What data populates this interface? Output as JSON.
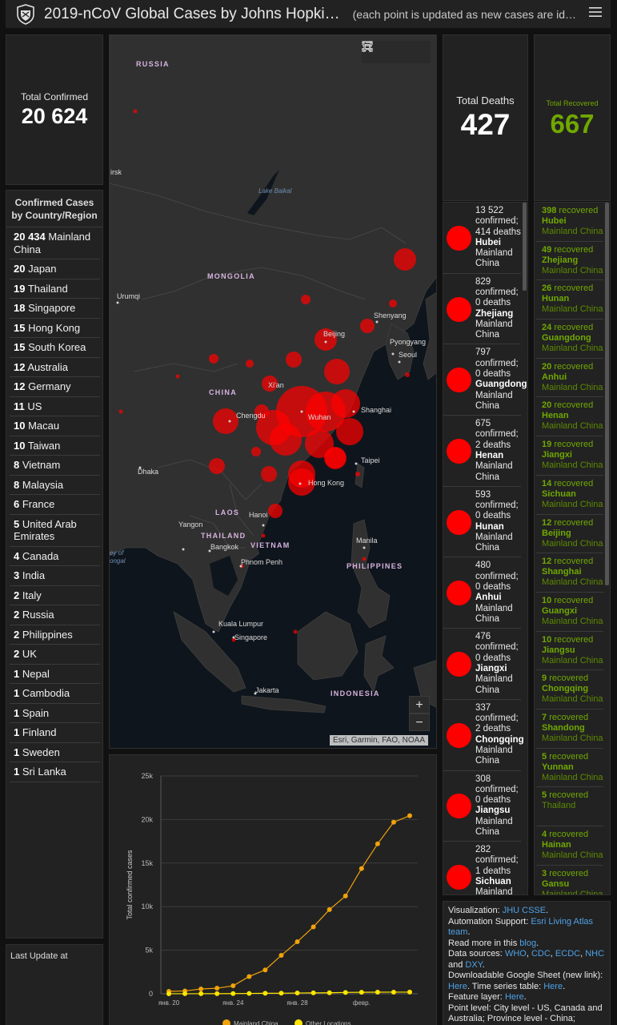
{
  "header": {
    "title": "2019-nCoV Global Cases by Johns Hopki…",
    "subtitle": "(each point is updated as new cases are id…"
  },
  "total_confirmed": {
    "label": "Total Confirmed",
    "value": "20 624"
  },
  "country_list": {
    "title": "Confirmed Cases by Country/Region",
    "items": [
      {
        "count": "20 434",
        "name": "Mainland China"
      },
      {
        "count": "20",
        "name": "Japan"
      },
      {
        "count": "19",
        "name": "Thailand"
      },
      {
        "count": "18",
        "name": "Singapore"
      },
      {
        "count": "15",
        "name": "Hong Kong"
      },
      {
        "count": "15",
        "name": "South Korea"
      },
      {
        "count": "12",
        "name": "Australia"
      },
      {
        "count": "12",
        "name": "Germany"
      },
      {
        "count": "11",
        "name": "US"
      },
      {
        "count": "10",
        "name": "Macau"
      },
      {
        "count": "10",
        "name": "Taiwan"
      },
      {
        "count": "8",
        "name": "Vietnam"
      },
      {
        "count": "8",
        "name": "Malaysia"
      },
      {
        "count": "6",
        "name": "France"
      },
      {
        "count": "5",
        "name": "United Arab Emirates"
      },
      {
        "count": "4",
        "name": "Canada"
      },
      {
        "count": "3",
        "name": "India"
      },
      {
        "count": "2",
        "name": "Italy"
      },
      {
        "count": "2",
        "name": "Russia"
      },
      {
        "count": "2",
        "name": "Philippines"
      },
      {
        "count": "2",
        "name": "UK"
      },
      {
        "count": "1",
        "name": "Nepal"
      },
      {
        "count": "1",
        "name": "Cambodia"
      },
      {
        "count": "1",
        "name": "Spain"
      },
      {
        "count": "1",
        "name": "Finland"
      },
      {
        "count": "1",
        "name": "Sweden"
      },
      {
        "count": "1",
        "name": "Sri Lanka"
      }
    ]
  },
  "last_update": {
    "label": "Last Update at"
  },
  "map": {
    "labels": {
      "russia": "RUSSIA",
      "mongolia": "MONGOLIA",
      "china": "CHINA",
      "laos": "LAOS",
      "thailand": "THAILAND",
      "vietnam": "VIETNAM",
      "philippines": "PHILIPPINES",
      "indonesia": "INDONESIA",
      "lake_baikal": "Lake Baikal",
      "bay_of_bengal": "ey of ongal",
      "irsk": "irsk",
      "urumqi": "Urumqi",
      "beijing": "Beijing",
      "shenyang": "Shenyang",
      "pyongyang": "Pyongyang",
      "seoul": "Seoul",
      "xian": "Xi'an",
      "chengdu": "Chengdu",
      "wuhan": "Wuhan",
      "shanghai": "Shanghai",
      "taipei": "Taipei",
      "dhaka": "Dhaka",
      "hanoi": "Hanoi",
      "hong_kong": "Hong Kong",
      "yangon": "Yangon",
      "bangkok": "Bangkok",
      "manila": "Manila",
      "phnom_penh": "Phnom Penh",
      "kuala_lumpur": "Kuala Lumpur",
      "singapore": "Singapore",
      "jakarta": "Jakarta"
    },
    "attribution": "Esri, Garmin, FAO, NOAA",
    "zoom_in": "+",
    "zoom_out": "−"
  },
  "total_deaths": {
    "label": "Total Deaths",
    "value": "427"
  },
  "deaths_list": [
    {
      "confirmed": "13 522",
      "deaths": "414",
      "province": "Hubei",
      "country": "Mainland China"
    },
    {
      "confirmed": "829",
      "deaths": "0",
      "province": "Zhejiang",
      "country": "Mainland China"
    },
    {
      "confirmed": "797",
      "deaths": "0",
      "province": "Guangdong",
      "country": "Mainland China"
    },
    {
      "confirmed": "675",
      "deaths": "2",
      "province": "Henan",
      "country": "Mainland China"
    },
    {
      "confirmed": "593",
      "deaths": "0",
      "province": "Hunan",
      "country": "Mainland China"
    },
    {
      "confirmed": "480",
      "deaths": "0",
      "province": "Anhui",
      "country": "Mainland China"
    },
    {
      "confirmed": "476",
      "deaths": "0",
      "province": "Jiangxi",
      "country": "Mainland China"
    },
    {
      "confirmed": "337",
      "deaths": "2",
      "province": "Chongqing",
      "country": "Mainland China"
    },
    {
      "confirmed": "308",
      "deaths": "0",
      "province": "Jiangsu",
      "country": "Mainland China"
    },
    {
      "confirmed": "282",
      "deaths": "1",
      "province": "Sichuan",
      "country": "Mainland China"
    }
  ],
  "total_recovered": {
    "label": "Total Recovered",
    "value": "667"
  },
  "recovered_list": [
    {
      "count": "398",
      "province": "Hubei",
      "country": "Mainland China"
    },
    {
      "count": "49",
      "province": "Zhejiang",
      "country": "Mainland China"
    },
    {
      "count": "26",
      "province": "Hunan",
      "country": "Mainland China"
    },
    {
      "count": "24",
      "province": "Guangdong",
      "country": "Mainland China"
    },
    {
      "count": "20",
      "province": "Anhui",
      "country": "Mainland China"
    },
    {
      "count": "20",
      "province": "Henan",
      "country": "Mainland China"
    },
    {
      "count": "19",
      "province": "Jiangxi",
      "country": "Mainland China"
    },
    {
      "count": "14",
      "province": "Sichuan",
      "country": "Mainland China"
    },
    {
      "count": "12",
      "province": "Beijing",
      "country": "Mainland China"
    },
    {
      "count": "12",
      "province": "Shanghai",
      "country": "Mainland China"
    },
    {
      "count": "10",
      "province": "Guangxi",
      "country": "Mainland China"
    },
    {
      "count": "10",
      "province": "Jiangsu",
      "country": "Mainland China"
    },
    {
      "count": "9",
      "province": "Chongqing",
      "country": "Mainland China"
    },
    {
      "count": "7",
      "province": "Shandong",
      "country": "Mainland China"
    },
    {
      "count": "5",
      "province": "Yunnan",
      "country": "Mainland China"
    },
    {
      "count": "5",
      "province": "",
      "country": "Thailand"
    },
    {
      "count": "4",
      "province": "Hainan",
      "country": "Mainland China"
    },
    {
      "count": "3",
      "province": "Gansu",
      "country": "Mainland China"
    }
  ],
  "recovered_word": "recovered",
  "confirmed_word": "confirmed;",
  "deaths_word": "deaths",
  "info": {
    "visualization_label": "Visualization:",
    "visualization_link": "JHU CSSE",
    "automation_label": "Automation Support:",
    "automation_link": "Esri Living Atlas team",
    "read_more_label": "Read more in this",
    "read_more_link": "blog",
    "sources_label": "Data sources:",
    "sources_links": [
      "WHO",
      "CDC",
      "ECDC",
      "NHC",
      "DXY"
    ],
    "sheet_label": "Downloadable Google Sheet (new link):",
    "sheet_link": "Here",
    "timeseries_label": "Time series table:",
    "timeseries_link": "Here",
    "feature_label": "Feature layer:",
    "feature_link": "Here",
    "point_level": "Point level: City level - US, Canada and Australia; Province level - China;"
  },
  "chart_data": {
    "type": "line",
    "ylabel": "Total confirmed cases",
    "xlabel": "",
    "x_tick_labels": [
      "янв. 20",
      "янв. 24",
      "янв. 28",
      "февр."
    ],
    "y_tick_labels": [
      "0",
      "5k",
      "10k",
      "15k",
      "20k",
      "25k"
    ],
    "ylim": [
      0,
      25000
    ],
    "x": [
      "01-20",
      "01-21",
      "01-22",
      "01-23",
      "01-24",
      "01-25",
      "01-26",
      "01-27",
      "01-28",
      "01-29",
      "01-30",
      "01-31",
      "02-01",
      "02-02",
      "02-03",
      "02-04"
    ],
    "series": [
      {
        "name": "Mainland China",
        "color": "#f0a30a",
        "values": [
          278,
          326,
          547,
          639,
          916,
          1979,
          2737,
          4409,
          5970,
          7678,
          9658,
          11221,
          14375,
          17205,
          19693,
          20434
        ]
      },
      {
        "name": "Other Locations",
        "color": "#ffe600",
        "values": [
          4,
          6,
          8,
          14,
          25,
          40,
          57,
          64,
          87,
          105,
          118,
          153,
          173,
          183,
          188,
          190
        ]
      }
    ],
    "legend": "bottom",
    "grid": true
  }
}
